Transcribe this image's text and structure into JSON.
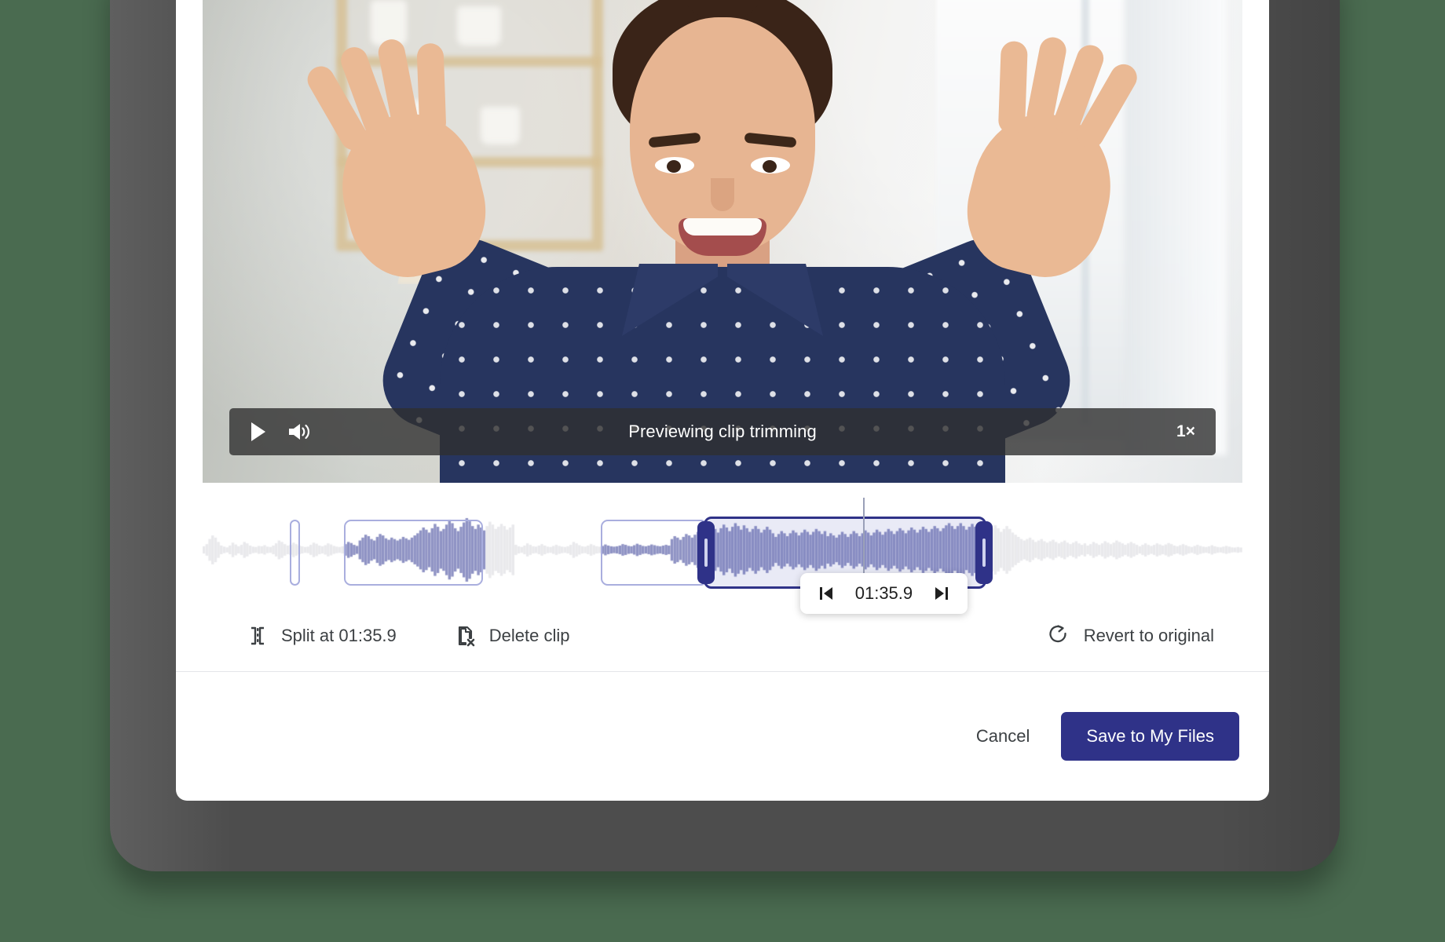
{
  "player": {
    "play_label": "Play",
    "play_icon": "play-icon",
    "volume_icon": "volume-icon",
    "status_text": "Previewing clip trimming",
    "speed_label": "1×"
  },
  "timeline": {
    "playhead_time": "01:35.9",
    "prev_icon": "skip-previous-icon",
    "next_icon": "skip-next-icon",
    "clips": [
      {
        "left_pct": 8.4,
        "width_pct": 1.0,
        "selected": false
      },
      {
        "left_pct": 13.6,
        "width_pct": 13.4,
        "selected": false
      },
      {
        "left_pct": 38.3,
        "width_pct": 10.3,
        "selected": false
      },
      {
        "left_pct": 48.2,
        "width_pct": 27.2,
        "selected": true
      }
    ],
    "playhead_pct": 63.5
  },
  "actions": {
    "split_label": "Split at 01:35.9",
    "split_icon": "split-clip-icon",
    "delete_label": "Delete clip",
    "delete_icon": "delete-file-icon",
    "revert_label": "Revert to original",
    "revert_icon": "rotate-right-icon"
  },
  "footer": {
    "cancel_label": "Cancel",
    "save_label": "Save to My Files"
  },
  "colors": {
    "accent": "#2f3288",
    "clip_outline": "#a9aede",
    "wave_active": "#8f93c4",
    "wave_inactive": "#e9e9ec",
    "page_bg": "#4a6b50",
    "bezel": "#4d4d4d"
  },
  "wave": {
    "amplitudes": [
      0.1,
      0.16,
      0.3,
      0.4,
      0.34,
      0.22,
      0.12,
      0.09,
      0.07,
      0.12,
      0.2,
      0.15,
      0.1,
      0.14,
      0.22,
      0.18,
      0.12,
      0.09,
      0.08,
      0.11,
      0.1,
      0.13,
      0.09,
      0.08,
      0.12,
      0.18,
      0.26,
      0.22,
      0.16,
      0.12,
      0.14,
      0.2,
      0.16,
      0.12,
      0.1,
      0.08,
      0.09,
      0.14,
      0.2,
      0.17,
      0.12,
      0.1,
      0.13,
      0.18,
      0.15,
      0.11,
      0.09,
      0.08,
      0.1,
      0.16,
      0.22,
      0.19,
      0.14,
      0.11,
      0.26,
      0.34,
      0.42,
      0.38,
      0.3,
      0.26,
      0.36,
      0.44,
      0.4,
      0.32,
      0.28,
      0.34,
      0.3,
      0.26,
      0.3,
      0.36,
      0.32,
      0.28,
      0.34,
      0.4,
      0.46,
      0.54,
      0.62,
      0.56,
      0.48,
      0.6,
      0.72,
      0.64,
      0.52,
      0.58,
      0.7,
      0.82,
      0.74,
      0.6,
      0.52,
      0.64,
      0.76,
      0.88,
      0.8,
      0.66,
      0.58,
      0.7,
      0.62,
      0.54,
      0.66,
      0.78,
      0.7,
      0.58,
      0.64,
      0.72,
      0.66,
      0.56,
      0.62,
      0.7,
      0.14,
      0.1,
      0.08,
      0.12,
      0.18,
      0.14,
      0.1,
      0.09,
      0.12,
      0.16,
      0.12,
      0.09,
      0.08,
      0.11,
      0.14,
      0.11,
      0.09,
      0.08,
      0.1,
      0.14,
      0.22,
      0.18,
      0.13,
      0.1,
      0.09,
      0.12,
      0.16,
      0.13,
      0.1,
      0.09,
      0.11,
      0.15,
      0.12,
      0.1,
      0.09,
      0.1,
      0.12,
      0.16,
      0.14,
      0.11,
      0.1,
      0.13,
      0.17,
      0.14,
      0.11,
      0.1,
      0.12,
      0.15,
      0.13,
      0.11,
      0.1,
      0.12,
      0.14,
      0.12,
      0.3,
      0.38,
      0.34,
      0.28,
      0.36,
      0.44,
      0.4,
      0.34,
      0.42,
      0.5,
      0.58,
      0.52,
      0.44,
      0.56,
      0.66,
      0.58,
      0.48,
      0.6,
      0.7,
      0.62,
      0.52,
      0.64,
      0.74,
      0.66,
      0.56,
      0.68,
      0.6,
      0.5,
      0.58,
      0.66,
      0.58,
      0.48,
      0.56,
      0.64,
      0.56,
      0.46,
      0.36,
      0.44,
      0.52,
      0.46,
      0.38,
      0.46,
      0.54,
      0.48,
      0.4,
      0.48,
      0.56,
      0.5,
      0.42,
      0.5,
      0.58,
      0.52,
      0.44,
      0.52,
      0.38,
      0.46,
      0.4,
      0.34,
      0.42,
      0.5,
      0.44,
      0.36,
      0.44,
      0.52,
      0.46,
      0.38,
      0.46,
      0.54,
      0.48,
      0.4,
      0.48,
      0.56,
      0.5,
      0.42,
      0.5,
      0.58,
      0.52,
      0.44,
      0.52,
      0.6,
      0.54,
      0.46,
      0.54,
      0.62,
      0.56,
      0.48,
      0.56,
      0.64,
      0.58,
      0.5,
      0.58,
      0.66,
      0.6,
      0.52,
      0.6,
      0.68,
      0.74,
      0.66,
      0.58,
      0.66,
      0.74,
      0.66,
      0.56,
      0.64,
      0.72,
      0.64,
      0.54,
      0.62,
      0.7,
      0.62,
      0.52,
      0.6,
      0.68,
      0.6,
      0.5,
      0.58,
      0.66,
      0.58,
      0.48,
      0.42,
      0.36,
      0.3,
      0.26,
      0.3,
      0.34,
      0.28,
      0.22,
      0.26,
      0.3,
      0.24,
      0.2,
      0.24,
      0.28,
      0.22,
      0.18,
      0.22,
      0.26,
      0.2,
      0.16,
      0.2,
      0.24,
      0.18,
      0.14,
      0.18,
      0.12,
      0.16,
      0.22,
      0.18,
      0.14,
      0.18,
      0.24,
      0.2,
      0.16,
      0.2,
      0.26,
      0.22,
      0.18,
      0.14,
      0.18,
      0.22,
      0.18,
      0.14,
      0.1,
      0.14,
      0.18,
      0.14,
      0.11,
      0.14,
      0.18,
      0.15,
      0.12,
      0.15,
      0.19,
      0.16,
      0.12,
      0.1,
      0.13,
      0.16,
      0.13,
      0.1,
      0.08,
      0.11,
      0.14,
      0.11,
      0.09,
      0.08,
      0.1,
      0.13,
      0.1,
      0.08,
      0.07,
      0.09,
      0.11,
      0.09,
      0.07,
      0.06,
      0.08,
      0.06
    ]
  }
}
